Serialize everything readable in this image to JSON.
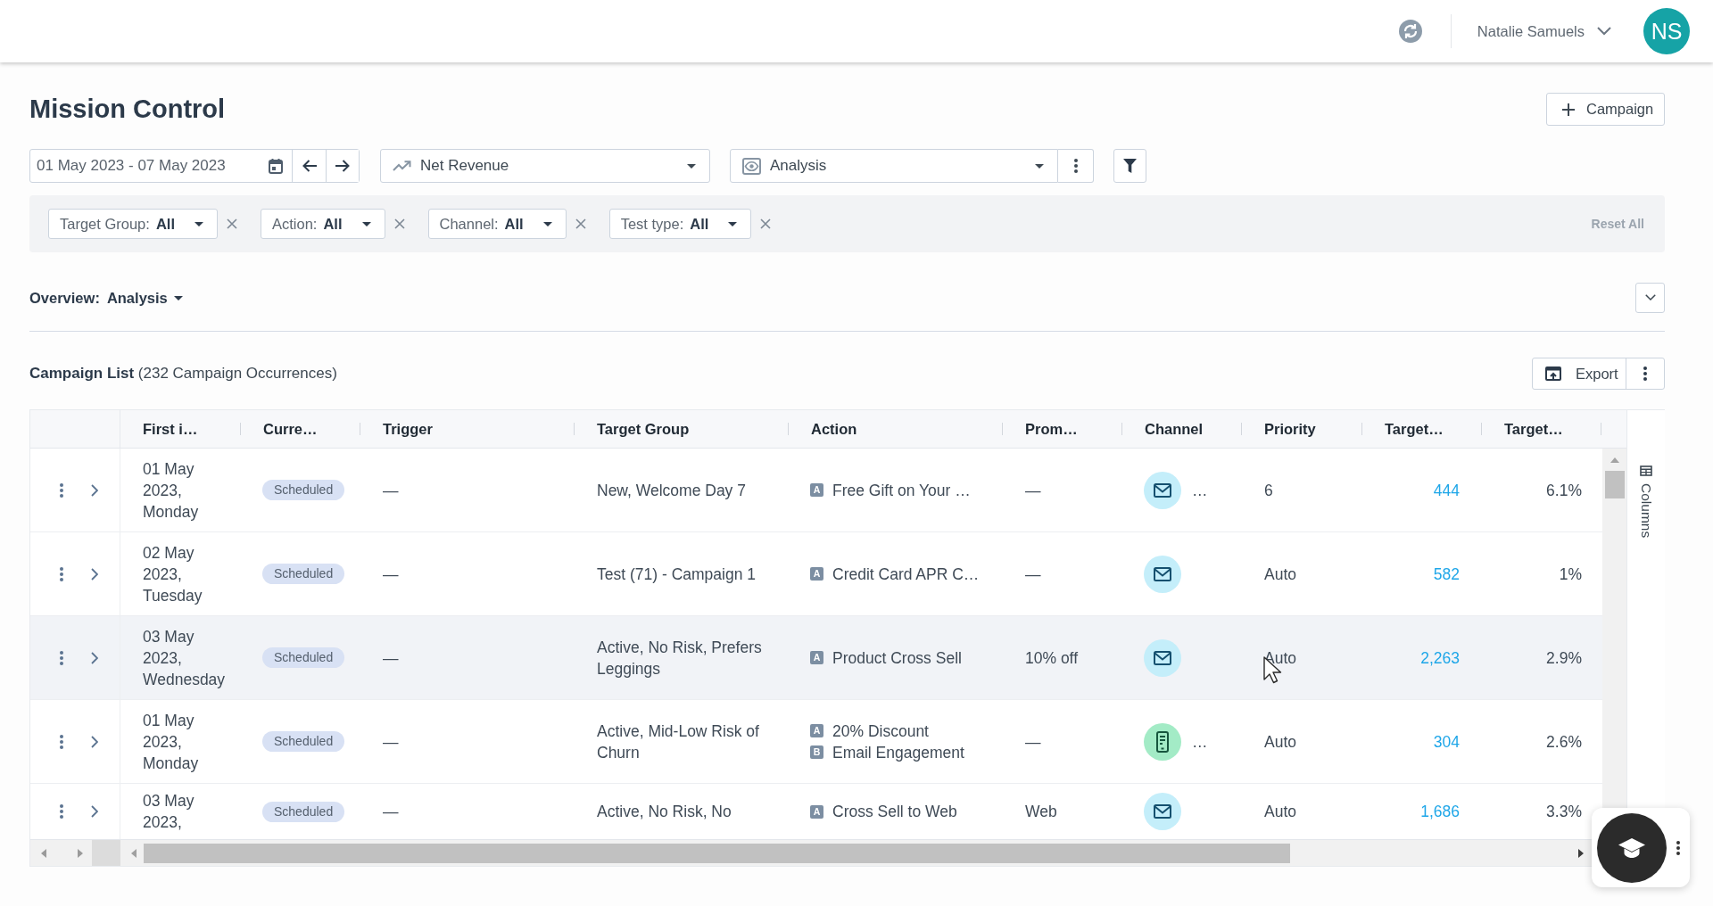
{
  "top_bar": {
    "user_name": "Natalie Samuels",
    "avatar_initials": "NS"
  },
  "page_title": "Mission Control",
  "add_campaign_button": "Campaign",
  "toolbar": {
    "date_range": "01 May 2023 - 07 May 2023",
    "metric": "Net Revenue",
    "view": "Analysis"
  },
  "filters": {
    "chips": [
      {
        "label": "Target Group:",
        "value": "All"
      },
      {
        "label": "Action:",
        "value": "All"
      },
      {
        "label": "Channel:",
        "value": "All"
      },
      {
        "label": "Test type:",
        "value": "All"
      }
    ],
    "reset": {
      "label": "Reset All",
      "disabled": true
    }
  },
  "overview": {
    "label": "Overview:",
    "value": "Analysis"
  },
  "campaign_list": {
    "heading": "**Campaign List** (232 Campaign Occurrences)",
    "export_button": "Export"
  },
  "table": {
    "columns": [
      "First i…",
      "Curre…",
      "Trigger",
      "Target Group",
      "Action",
      "Prom…",
      "Channel",
      "Priority",
      "Target…",
      "Target…"
    ],
    "rows": [
      {
        "date": "01 May 2023, Monday",
        "status": "Scheduled",
        "trigger": "—",
        "target_group": "New, Welcome Day 7",
        "actions": [
          {
            "variant": "A",
            "name": "Free Gift on Your …"
          }
        ],
        "column_6": "—",
        "channel": {
          "kind": "email",
          "more": "…"
        },
        "priority": "6",
        "column_9": "444",
        "column_10": "6.1%",
        "highlighted": false
      },
      {
        "date": "02 May 2023, Tuesday",
        "status": "Scheduled",
        "trigger": "—",
        "target_group": "Test (71) - Campaign 1",
        "actions": [
          {
            "variant": "A",
            "name": "Credit Card APR C…"
          }
        ],
        "column_6": "—",
        "channel": {
          "kind": "email"
        },
        "priority": "Auto",
        "column_9": "582",
        "column_10": "1%",
        "highlighted": false
      },
      {
        "date": "03 May 2023, Wednesday",
        "status": "Scheduled",
        "trigger": "—",
        "target_group": "Active, No Risk, Prefers Leggings",
        "actions": [
          {
            "variant": "A",
            "name": "Product Cross Sell"
          }
        ],
        "column_6": "10% off",
        "channel": {
          "kind": "email"
        },
        "priority": "Auto",
        "column_9": "2,263",
        "column_10": "2.9%",
        "highlighted": true
      },
      {
        "date": "01 May 2023, Monday",
        "status": "Scheduled",
        "trigger": "—",
        "target_group": "Active, Mid-Low Risk of Churn",
        "actions": [
          {
            "variant": "A",
            "name": "20% Discount"
          },
          {
            "variant": "B",
            "name": "Email Engagement"
          }
        ],
        "column_6": "—",
        "channel": {
          "kind": "mobile",
          "more": "…"
        },
        "priority": "Auto",
        "column_9": "304",
        "column_10": "2.6%",
        "highlighted": false
      },
      {
        "date": "03 May 2023,",
        "status": "Scheduled",
        "trigger": "—",
        "target_group": "Active, No Risk, No",
        "actions": [
          {
            "variant": "A",
            "name": "Cross Sell to Web"
          }
        ],
        "column_6": "Web",
        "channel": {
          "kind": "email"
        },
        "priority": "Auto",
        "column_9": "1,686",
        "column_10": "3.3%",
        "highlighted": false
      }
    ]
  },
  "columns_panel": {
    "label": "Columns"
  }
}
